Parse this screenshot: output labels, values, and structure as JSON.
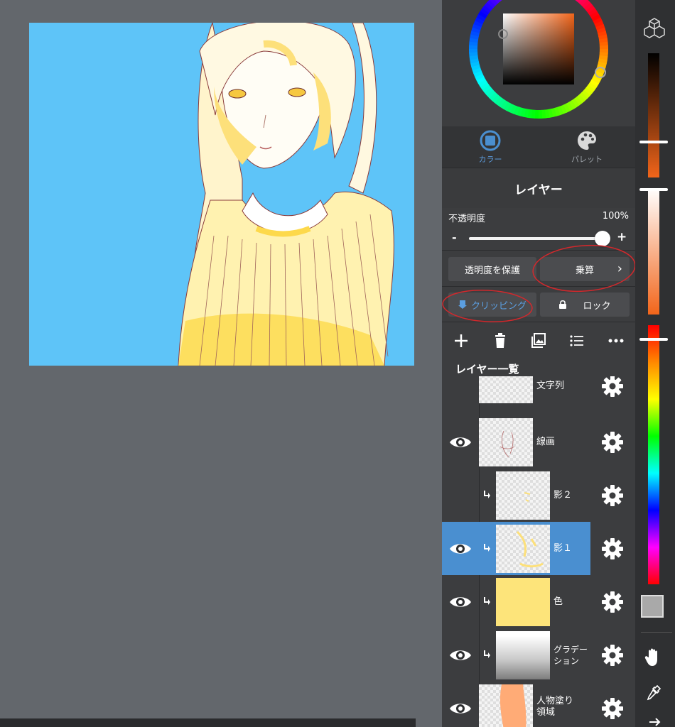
{
  "color_tabs": [
    {
      "label": "カラー",
      "icon": "color-disc-icon",
      "active": true
    },
    {
      "label": "パレット",
      "icon": "palette-icon",
      "active": false
    }
  ],
  "layer_panel": {
    "title": "レイヤー",
    "opacity_label": "不透明度",
    "opacity_value": "100%",
    "opacity_fraction": 1.0,
    "minus": "-",
    "plus": "+",
    "protect_alpha": "透明度を保護",
    "blend_mode": "乗算",
    "clipping": "クリッピング",
    "lock": "ロック"
  },
  "toolbar_icons": [
    "add-layer-icon",
    "trash-icon",
    "import-image-icon",
    "list-icon",
    "more-icon"
  ],
  "layer_list_title": "レイヤー一覧",
  "layers": [
    {
      "name": "文字列",
      "visible": false,
      "clipped": false,
      "selected": false
    },
    {
      "name": "線画",
      "visible": true,
      "clipped": false,
      "selected": false
    },
    {
      "name": "影２",
      "visible": false,
      "clipped": true,
      "selected": false
    },
    {
      "name": "影１",
      "visible": true,
      "clipped": true,
      "selected": true
    },
    {
      "name": "色",
      "visible": true,
      "clipped": true,
      "selected": false
    },
    {
      "name": "グラデー\nション",
      "visible": true,
      "clipped": true,
      "selected": false
    },
    {
      "name": "人物塗り\n領域",
      "visible": true,
      "clipped": false,
      "selected": false
    }
  ],
  "colors": {
    "canvas_bg": "#5ec4f8",
    "accent": "#4a8fd0",
    "annotation": "#d3282c",
    "layer_fill_yellow": "#fde47a"
  }
}
